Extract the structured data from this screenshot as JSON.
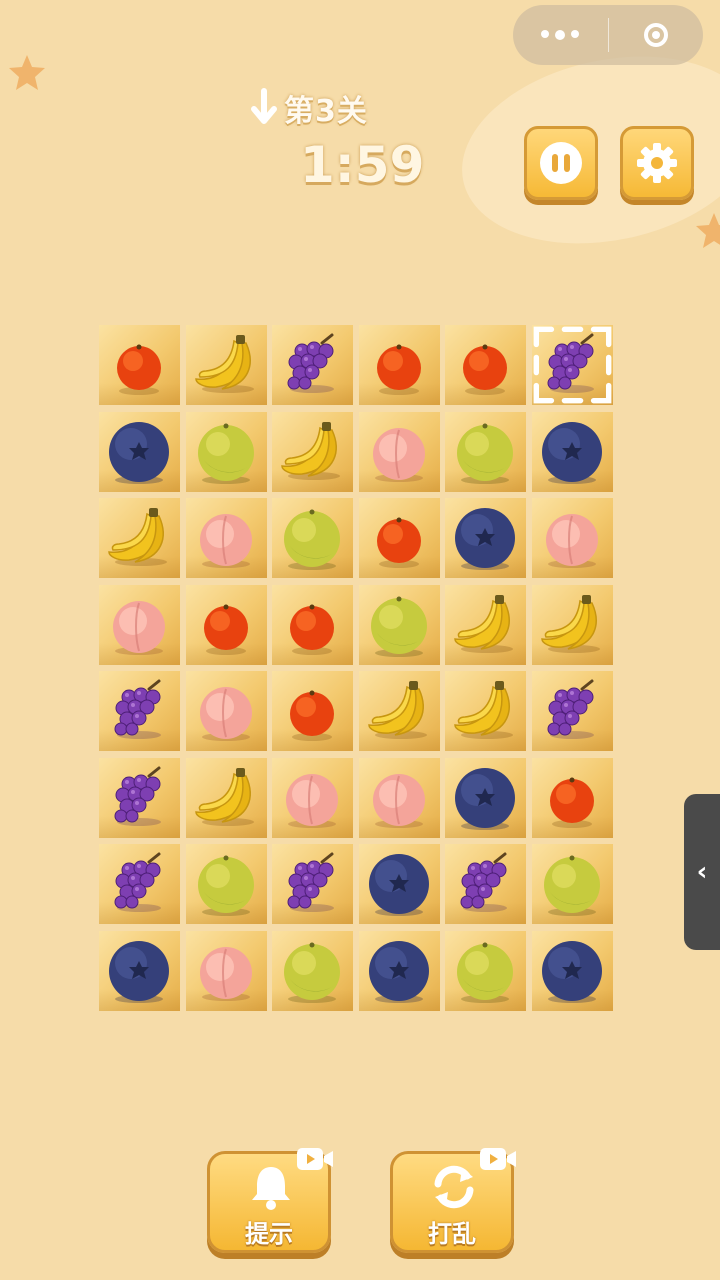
{
  "header": {
    "level": "第3关",
    "timer": "1:59"
  },
  "icons": {
    "capsule_more": "more-dots-icon",
    "capsule_close": "close-target-icon",
    "pause": "pause-icon",
    "settings": "gear-icon",
    "level_marker": "arrow-down-icon",
    "side_tab": "chevron-left-icon"
  },
  "board": {
    "rows": 8,
    "cols": 6,
    "selected": [
      0,
      5
    ],
    "tiles": [
      [
        "orange",
        "banana",
        "grape",
        "orange",
        "orange",
        "grape"
      ],
      [
        "blueberry",
        "lime",
        "banana",
        "peach",
        "lime",
        "blueberry"
      ],
      [
        "banana",
        "peach",
        "lime",
        "orange",
        "blueberry",
        "peach"
      ],
      [
        "peach",
        "orange",
        "orange",
        "lime",
        "banana",
        "banana"
      ],
      [
        "grape",
        "peach",
        "orange",
        "banana",
        "banana",
        "grape"
      ],
      [
        "grape",
        "banana",
        "peach",
        "peach",
        "blueberry",
        "orange"
      ],
      [
        "grape",
        "lime",
        "grape",
        "blueberry",
        "grape",
        "lime"
      ],
      [
        "blueberry",
        "peach",
        "lime",
        "blueberry",
        "lime",
        "blueberry"
      ]
    ]
  },
  "powerups": {
    "hint_label": "提示",
    "shuffle_label": "打乱"
  },
  "colors": {
    "background": "#f6dca9",
    "button": "#f6b936",
    "tile": "#f3c96e"
  }
}
